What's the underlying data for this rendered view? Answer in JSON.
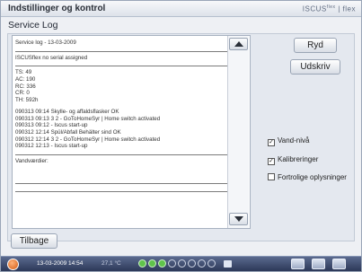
{
  "window": {
    "title": "Indstillinger og kontrol",
    "brand": "ISCUS",
    "brand_sup": "flex",
    "brand_suffix": "flex"
  },
  "page": {
    "subtitle": "Service Log"
  },
  "log": {
    "lines": [
      {
        "type": "text",
        "text": "Service log - 13-03-2009"
      },
      {
        "type": "sep"
      },
      {
        "type": "text",
        "text": "ISCUSflex no serial assigned"
      },
      {
        "type": "sep"
      },
      {
        "type": "text",
        "text": "TS: 49"
      },
      {
        "type": "text",
        "text": "AC: 190"
      },
      {
        "type": "text",
        "text": "RC: 336"
      },
      {
        "type": "text",
        "text": "CR: 0"
      },
      {
        "type": "text",
        "text": "TH: 592h"
      },
      {
        "type": "gap"
      },
      {
        "type": "text",
        "text": "090313 09:14 Skylle- og affaldsflasker OK"
      },
      {
        "type": "text",
        "text": "090313 09:13 3 2 - GoToHomeSyr | Home switch activated"
      },
      {
        "type": "text",
        "text": "090313 09:12 - Iscus start-up"
      },
      {
        "type": "text",
        "text": "090312 12:14 Spül/Abfall Behälter sind OK"
      },
      {
        "type": "text",
        "text": "090312 12:14 3 2 - GoToHomeSyr | Home switch activated"
      },
      {
        "type": "text",
        "text": "090312 12:13 - Iscus start-up"
      },
      {
        "type": "sep"
      },
      {
        "type": "text",
        "text": "Vandværdier:"
      },
      {
        "type": "gap"
      },
      {
        "type": "gap"
      },
      {
        "type": "gap"
      },
      {
        "type": "sep"
      },
      {
        "type": "sep"
      }
    ]
  },
  "buttons": {
    "clear": "Ryd",
    "print": "Udskriv",
    "back": "Tilbage"
  },
  "checkboxes": [
    {
      "label": "Vand-nivå",
      "checked": true
    },
    {
      "label": "Kalibreringer",
      "checked": true
    },
    {
      "label": "Fortrolige oplysninger",
      "checked": false
    }
  ],
  "taskbar": {
    "datetime": "13-03-2009 14:54",
    "temperature": "27,1 °C",
    "indicators_on": 3,
    "indicators_total": 8
  },
  "colors": {
    "accent_power": "#d35a12",
    "indicator_on": "#5fc34b",
    "taskbar": "#3b4870"
  }
}
